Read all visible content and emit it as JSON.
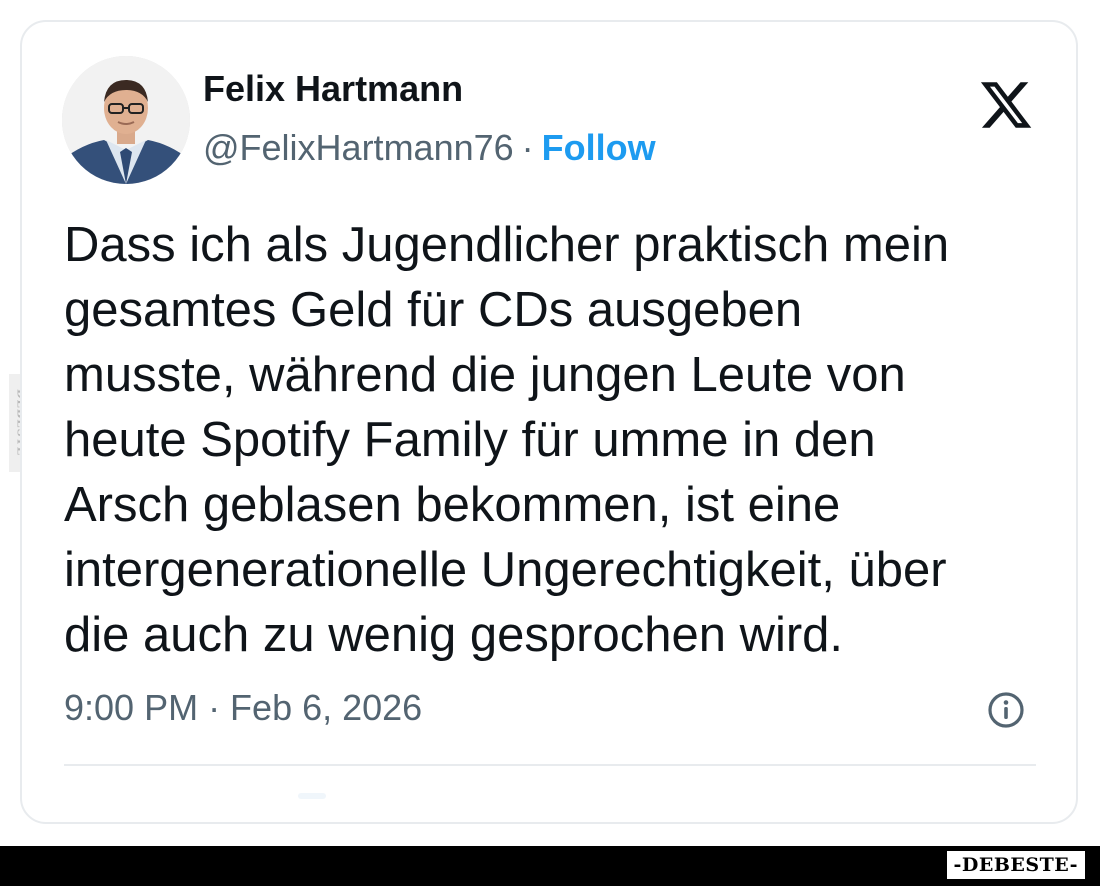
{
  "tweet": {
    "author_name": "Felix Hartmann",
    "handle": "@FelixHartmann76",
    "separator": "·",
    "follow_label": "Follow",
    "text": "Dass ich als Jugendlicher praktisch mein\ngesamtes Geld für CDs ausgeben\nmusste, während die jungen Leute von\nheute Spotify Family für umme in den\nArsch geblasen bekommen, ist eine\nintergenerationelle Ungerechtigkeit, über\ndie auch zu wenig gesprochen wird.",
    "timestamp": "9:00 PM · Feb 6, 2026",
    "platform_icon": "x-logo-icon",
    "info_icon": "info-icon"
  },
  "watermark": {
    "bottom_text": "-DEBESTE-",
    "side_text": "DEBESTE"
  },
  "colors": {
    "text_primary": "#0f1419",
    "text_secondary": "#536471",
    "follow_blue": "#1d9bf0",
    "card_border": "#e8ebee",
    "bar": "#000000"
  }
}
